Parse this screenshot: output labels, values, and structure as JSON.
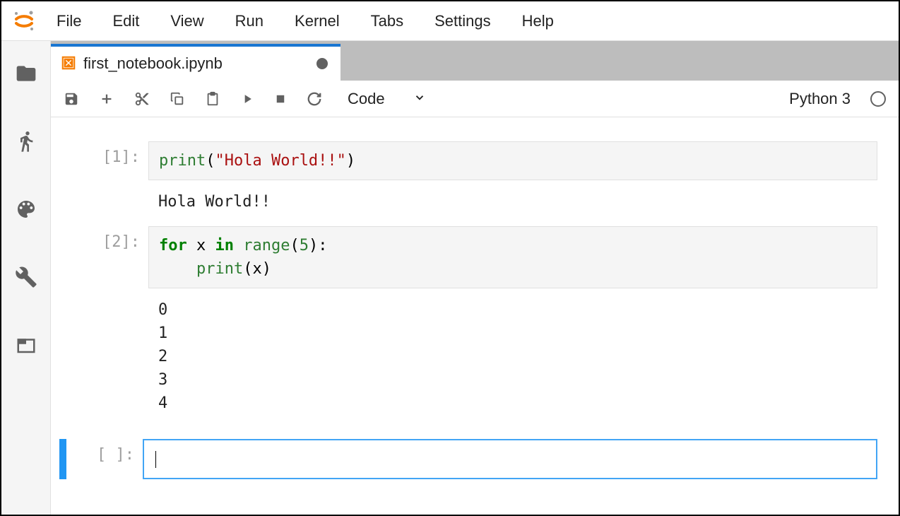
{
  "menu": {
    "items": [
      "File",
      "Edit",
      "View",
      "Run",
      "Kernel",
      "Tabs",
      "Settings",
      "Help"
    ]
  },
  "tab": {
    "title": "first_notebook.ipynb",
    "dirty": true
  },
  "toolbar": {
    "celltype": "Code",
    "kernel": "Python 3"
  },
  "cells": [
    {
      "prompt": "[1]:",
      "code_tokens": [
        {
          "t": "print",
          "c": "tk-builtin"
        },
        {
          "t": "(",
          "c": ""
        },
        {
          "t": "\"Hola World!!\"",
          "c": "tk-string"
        },
        {
          "t": ")",
          "c": ""
        }
      ],
      "output": "Hola World!!"
    },
    {
      "prompt": "[2]:",
      "code_tokens": [
        {
          "t": "for",
          "c": "tk-keyword"
        },
        {
          "t": " x ",
          "c": ""
        },
        {
          "t": "in",
          "c": "tk-keyword"
        },
        {
          "t": " ",
          "c": ""
        },
        {
          "t": "range",
          "c": "tk-builtin"
        },
        {
          "t": "(",
          "c": ""
        },
        {
          "t": "5",
          "c": "tk-number"
        },
        {
          "t": "):\n    ",
          "c": ""
        },
        {
          "t": "print",
          "c": "tk-builtin"
        },
        {
          "t": "(x)",
          "c": ""
        }
      ],
      "output": "0\n1\n2\n3\n4"
    },
    {
      "prompt": "[ ]:",
      "code_tokens": [],
      "output": "",
      "active": true
    }
  ]
}
